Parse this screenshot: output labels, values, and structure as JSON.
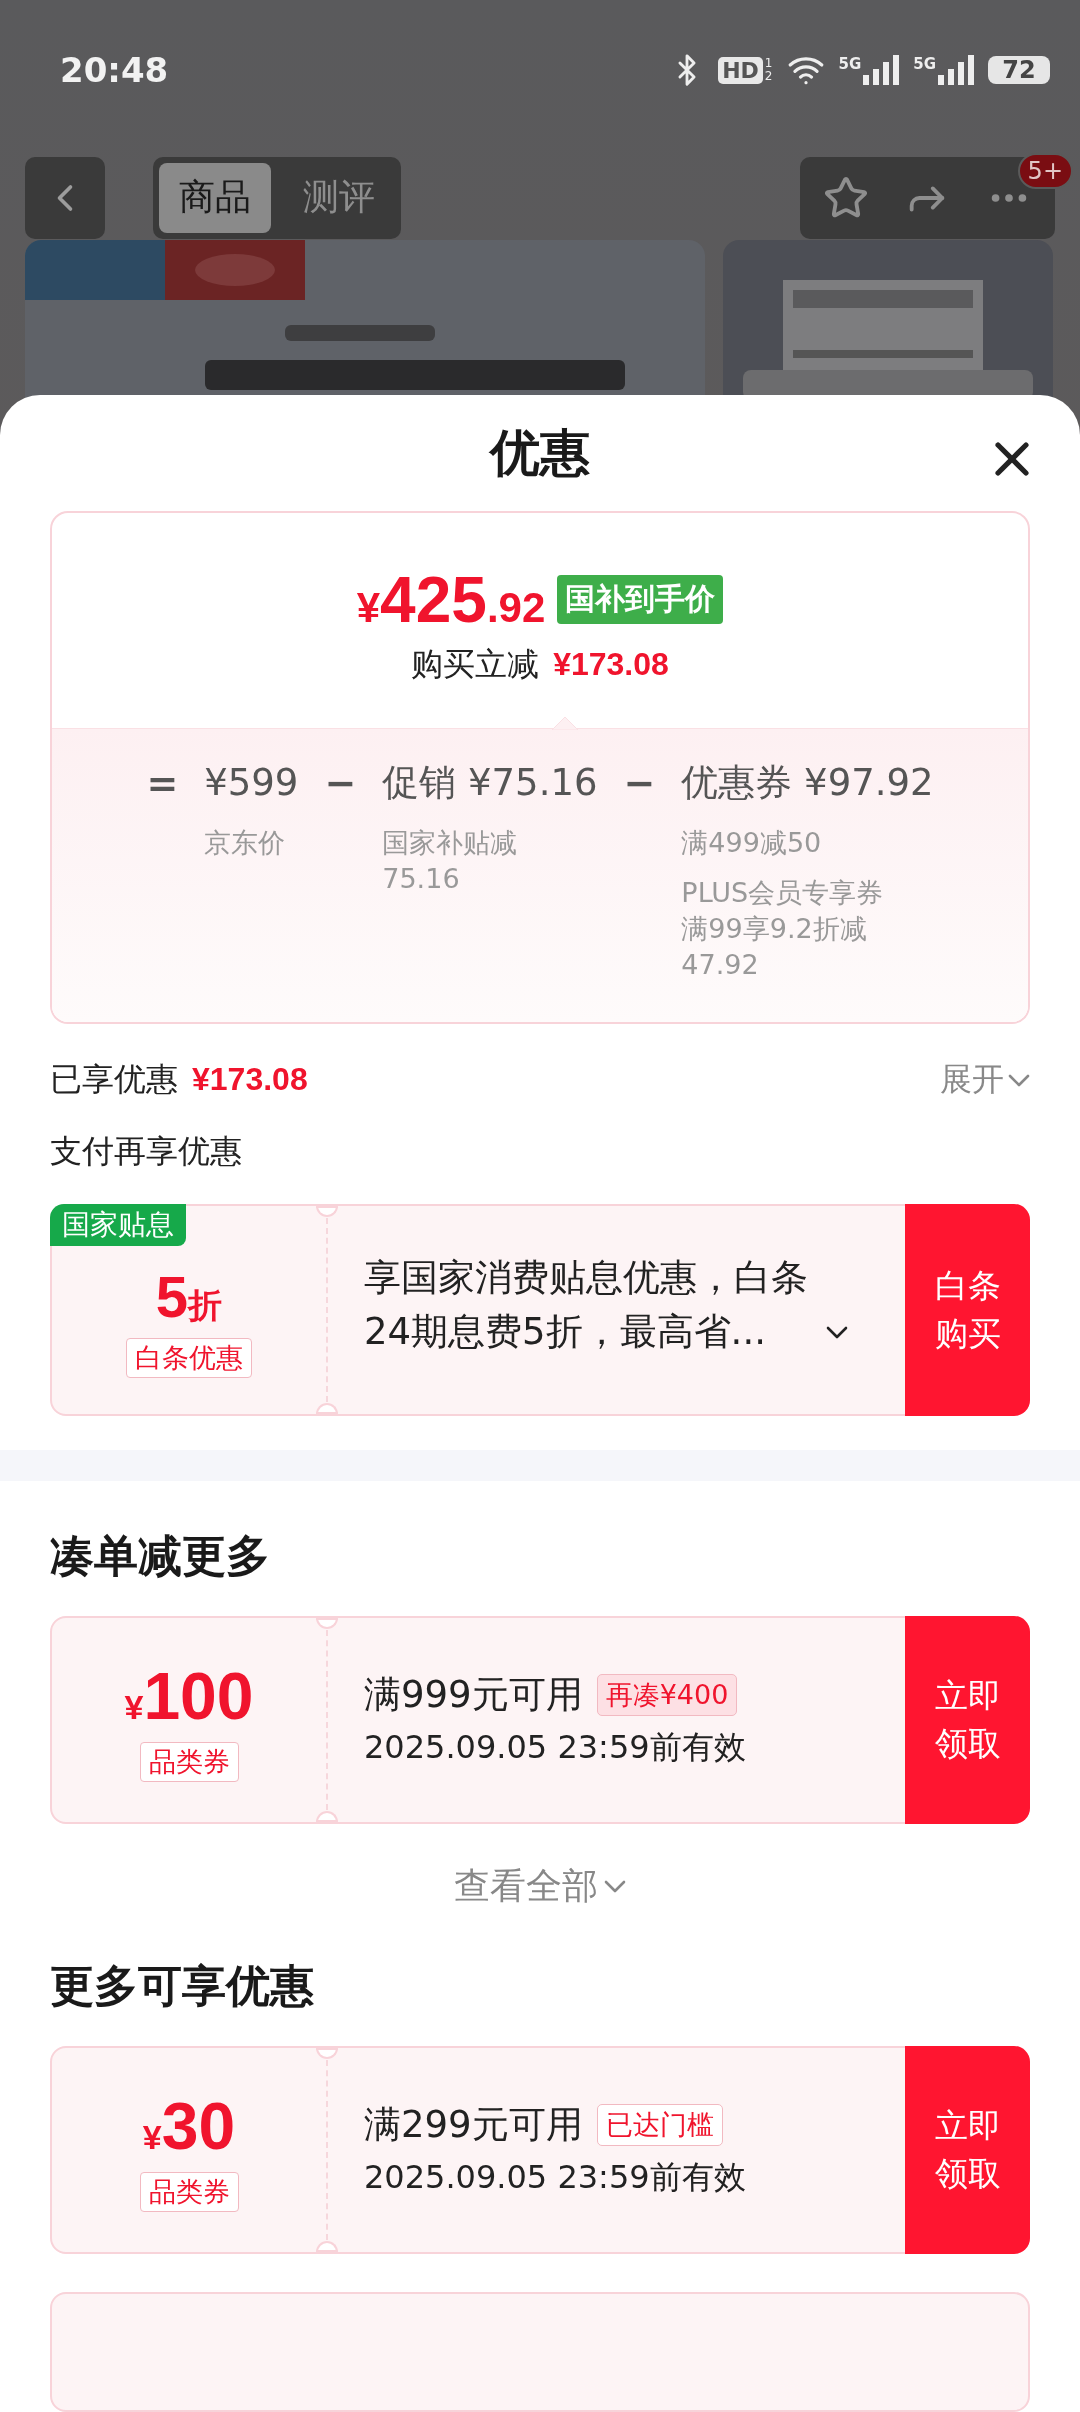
{
  "status_bar": {
    "time": "20:48",
    "hd": "HD",
    "hd_slots": [
      "1",
      "2"
    ],
    "networks": [
      "5G",
      "5G"
    ],
    "battery": "72"
  },
  "header": {
    "tabs": [
      {
        "label": "商品",
        "selected": true
      },
      {
        "label": "测评",
        "selected": false
      }
    ],
    "badge": "5+"
  },
  "sheet": {
    "title": "优惠",
    "price": {
      "currency": "¥",
      "integer": "425",
      "decimal": ".92",
      "tag": "国补到手价",
      "saving_label": "购买立减",
      "saving": "¥173.08"
    },
    "breakdown": [
      {
        "operator": "=",
        "amount": "¥599",
        "notes": [
          {
            "lines": [
              "京东价"
            ]
          }
        ]
      },
      {
        "operator": "−",
        "label": "促销",
        "amount": "¥75.16",
        "notes": [
          {
            "lines": [
              "国家补贴减",
              "75.16"
            ]
          }
        ]
      },
      {
        "operator": "−",
        "label": "优惠券",
        "amount": "¥97.92",
        "notes": [
          {
            "lines": [
              "满499减50"
            ]
          },
          {
            "lines": [
              "PLUS会员专享券",
              "满99享9.2折减",
              "47.92"
            ]
          }
        ]
      }
    ],
    "enjoyed": {
      "label": "已享优惠",
      "amount": "¥173.08",
      "expand": "展开"
    },
    "pay_title": "支付再享优惠",
    "pay_offer": {
      "ribbon": "国家贴息",
      "value": "5",
      "unit": "折",
      "tag": "白条优惠",
      "text": "享国家消费贴息优惠，白条24期息费5折，最高省...",
      "button": "白条购买"
    },
    "sections": [
      {
        "title": "凑单减更多",
        "coupons": [
          {
            "currency": "¥",
            "amount": "100",
            "type": "品类券",
            "condition": "满999元可用",
            "tag": "再凑¥400",
            "kind": "filled",
            "validity": "2025.09.05 23:59前有效",
            "button": "立即领取"
          }
        ],
        "more": "查看全部"
      },
      {
        "title": "更多可享优惠",
        "coupons": [
          {
            "currency": "¥",
            "amount": "30",
            "type": "品类券",
            "condition": "满299元可用",
            "tag": "已达门槛",
            "kind": "outlined",
            "validity": "2025.09.05 23:59前有效",
            "button": "立即领取"
          }
        ]
      }
    ]
  }
}
